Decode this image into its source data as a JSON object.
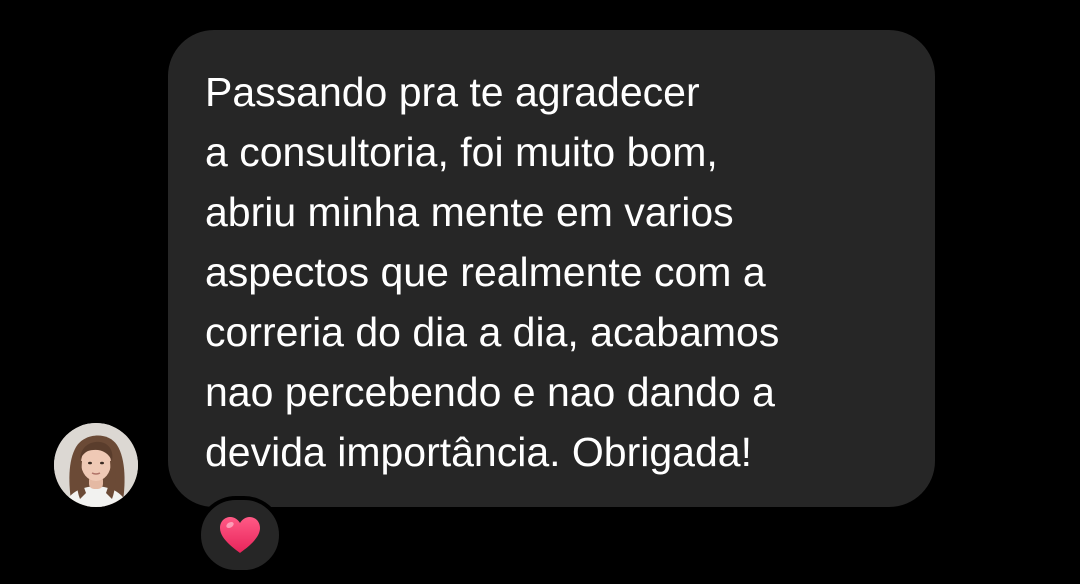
{
  "conversation": {
    "message": {
      "lines": [
        "Passando pra te agradecer",
        "a consultoria, foi muito bom,",
        "abriu minha mente em varios",
        "aspectos que realmente com a",
        "correria do dia a dia, acabamos",
        "nao percebendo e nao dando a",
        "devida importância. Obrigada!"
      ],
      "reaction": {
        "icon": "heart-icon",
        "color": "#ff3b6e"
      }
    },
    "sender": {
      "avatar_icon": "profile-photo"
    }
  },
  "theme": {
    "background": "#000000",
    "bubble_color": "#262626",
    "text_color": "#ffffff"
  }
}
